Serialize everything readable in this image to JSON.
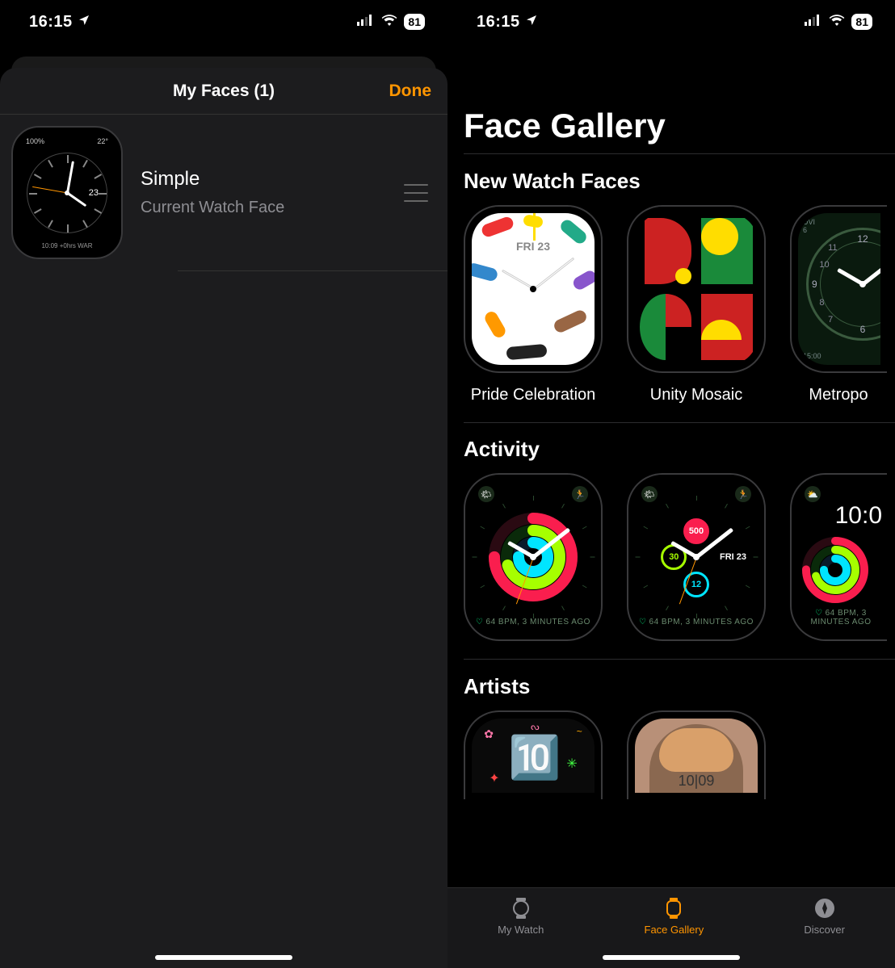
{
  "status": {
    "time": "16:15",
    "battery": "81"
  },
  "left": {
    "title": "My Faces (1)",
    "done": "Done",
    "face": {
      "name": "Simple",
      "subtitle": "Current Watch Face",
      "complication_left": "100%",
      "complication_right": "22°",
      "date": "23",
      "bottom_text": "10:09 +0hrs WAR"
    }
  },
  "right": {
    "page_title": "Face Gallery",
    "sections": {
      "new_faces": {
        "title": "New Watch Faces",
        "items": [
          {
            "label": "Pride Celebration",
            "date": "FRI 23"
          },
          {
            "label": "Unity Mosaic"
          },
          {
            "label": "Metropo"
          }
        ]
      },
      "activity": {
        "title": "Activity",
        "bpm_text": "64 BPM, 3 MINUTES AGO",
        "subdial_red": "500",
        "subdial_green": "30",
        "subdial_cyan": "12",
        "date2": "FRI 23",
        "digital_time": "10:0"
      },
      "artists": {
        "title": "Artists",
        "artist2_time": "10|09"
      }
    },
    "tabs": {
      "my_watch": "My Watch",
      "face_gallery": "Face Gallery",
      "discover": "Discover"
    }
  }
}
